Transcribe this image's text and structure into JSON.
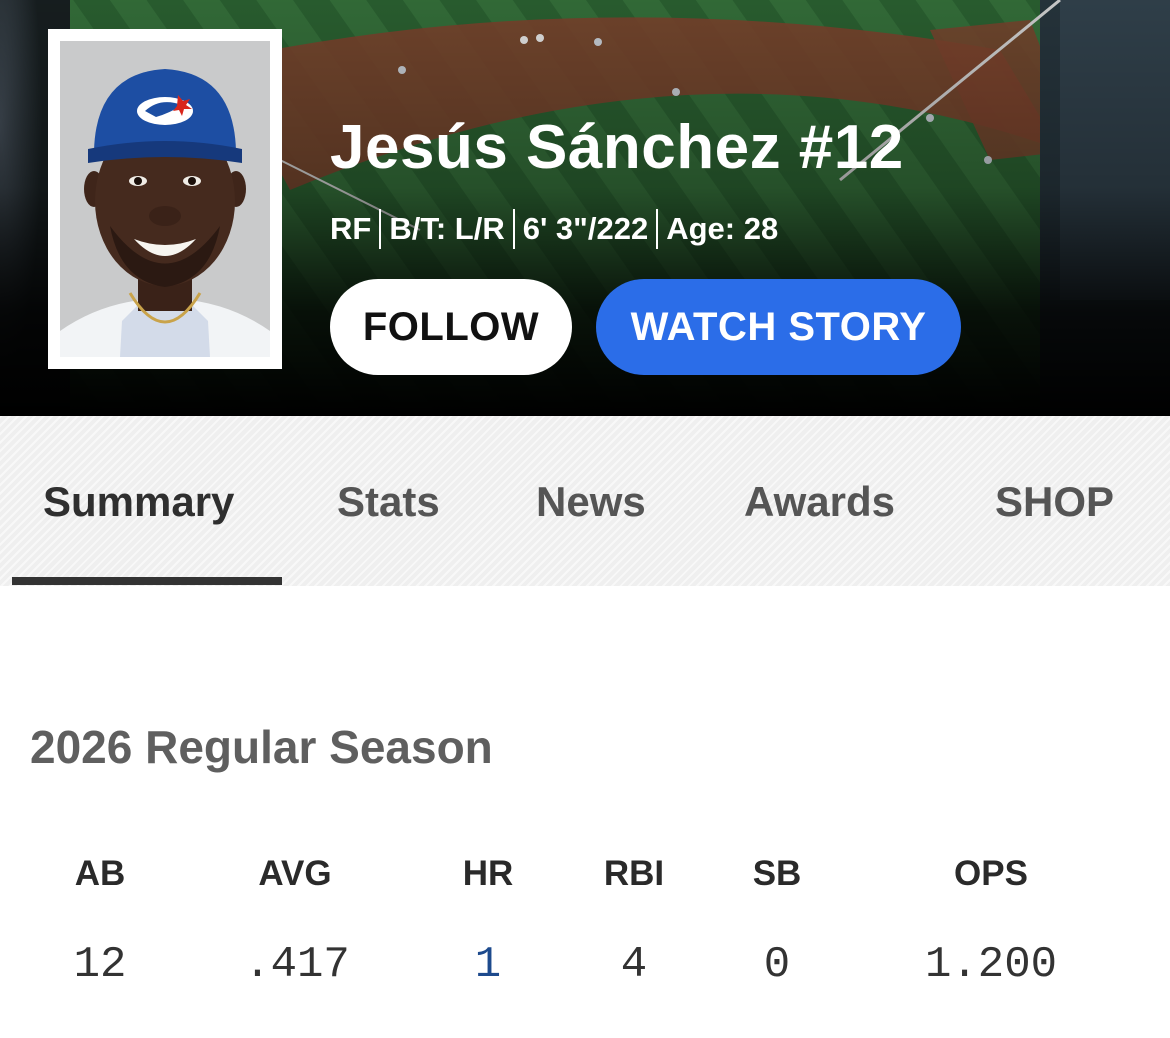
{
  "player": {
    "name": "Jesús Sánchez #12",
    "position": "RF",
    "bats_throws": "B/T: L/R",
    "height_weight": "6' 3\"/222",
    "age": "Age: 28",
    "team_cap_logo": "blue-jays-logo"
  },
  "actions": {
    "follow_label": "FOLLOW",
    "watch_story_label": "WATCH STORY"
  },
  "tabs": [
    {
      "label": "Summary",
      "active": true
    },
    {
      "label": "Stats",
      "active": false
    },
    {
      "label": "News",
      "active": false
    },
    {
      "label": "Awards",
      "active": false
    },
    {
      "label": "SHOP",
      "active": false
    }
  ],
  "season": {
    "title": "2026 Regular Season",
    "headers": [
      "AB",
      "AVG",
      "HR",
      "RBI",
      "SB",
      "OPS"
    ],
    "values": [
      "12",
      ".417",
      "1",
      "4",
      "0",
      "1.200"
    ]
  },
  "colors": {
    "accent_blue": "#2b6de8",
    "link_blue": "#1d4a8d",
    "tab_underline": "#333333"
  }
}
